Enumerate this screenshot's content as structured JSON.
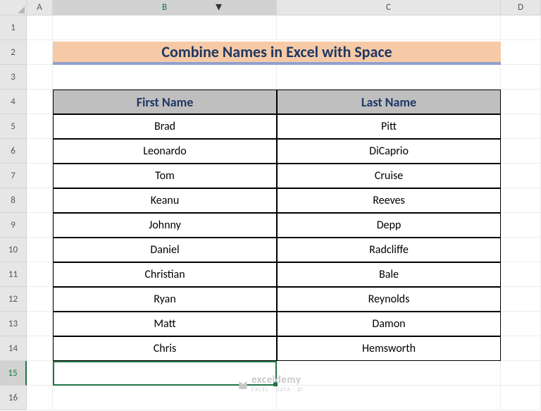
{
  "columns": [
    "A",
    "B",
    "C",
    "D"
  ],
  "rows": [
    "1",
    "2",
    "3",
    "4",
    "5",
    "6",
    "7",
    "8",
    "9",
    "10",
    "11",
    "12",
    "13",
    "14",
    "15",
    "16"
  ],
  "title": "Combine Names in Excel with Space",
  "headers": {
    "first": "First Name",
    "last": "Last Name"
  },
  "data": [
    {
      "first": "Brad",
      "last": "Pitt"
    },
    {
      "first": "Leonardo",
      "last": "DiCaprio"
    },
    {
      "first": "Tom",
      "last": "Cruise"
    },
    {
      "first": "Keanu",
      "last": "Reeves"
    },
    {
      "first": "Johnny",
      "last": "Depp"
    },
    {
      "first": "Daniel",
      "last": "Radcliffe"
    },
    {
      "first": "Christian",
      "last": "Bale"
    },
    {
      "first": "Ryan",
      "last": "Reynolds"
    },
    {
      "first": "Matt",
      "last": "Damon"
    },
    {
      "first": "Chris",
      "last": "Hemsworth"
    }
  ],
  "selected": {
    "col": "B",
    "row": "15"
  },
  "watermark": {
    "name": "exceldemy",
    "tag": "EXCEL · DATA · BI"
  }
}
